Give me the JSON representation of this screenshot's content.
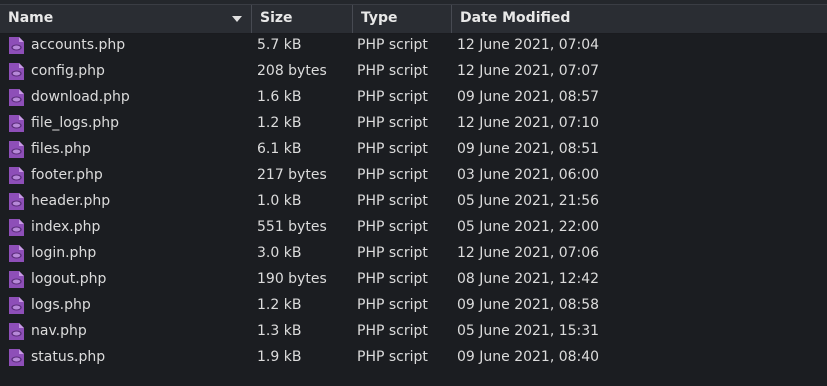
{
  "columns": {
    "name": "Name",
    "size": "Size",
    "type": "Type",
    "date": "Date Modified"
  },
  "sort": {
    "column": "name",
    "icon": "sort-descending-icon"
  },
  "file_icon": "php-file-icon",
  "accent_color": "#8e4fb8",
  "files": [
    {
      "name": "accounts.php",
      "size": "5.7 kB",
      "type": "PHP script",
      "date": "12 June 2021, 07:04"
    },
    {
      "name": "config.php",
      "size": "208 bytes",
      "type": "PHP script",
      "date": "12 June 2021, 07:07"
    },
    {
      "name": "download.php",
      "size": "1.6 kB",
      "type": "PHP script",
      "date": "09 June 2021, 08:57"
    },
    {
      "name": "file_logs.php",
      "size": "1.2 kB",
      "type": "PHP script",
      "date": "12 June 2021, 07:10"
    },
    {
      "name": "files.php",
      "size": "6.1 kB",
      "type": "PHP script",
      "date": "09 June 2021, 08:51"
    },
    {
      "name": "footer.php",
      "size": "217 bytes",
      "type": "PHP script",
      "date": "03 June 2021, 06:00"
    },
    {
      "name": "header.php",
      "size": "1.0 kB",
      "type": "PHP script",
      "date": "05 June 2021, 21:56"
    },
    {
      "name": "index.php",
      "size": "551 bytes",
      "type": "PHP script",
      "date": "05 June 2021, 22:00"
    },
    {
      "name": "login.php",
      "size": "3.0 kB",
      "type": "PHP script",
      "date": "12 June 2021, 07:06"
    },
    {
      "name": "logout.php",
      "size": "190 bytes",
      "type": "PHP script",
      "date": "08 June 2021, 12:42"
    },
    {
      "name": "logs.php",
      "size": "1.2 kB",
      "type": "PHP script",
      "date": "09 June 2021, 08:58"
    },
    {
      "name": "nav.php",
      "size": "1.3 kB",
      "type": "PHP script",
      "date": "05 June 2021, 15:31"
    },
    {
      "name": "status.php",
      "size": "1.9 kB",
      "type": "PHP script",
      "date": "09 June 2021, 08:40"
    }
  ]
}
